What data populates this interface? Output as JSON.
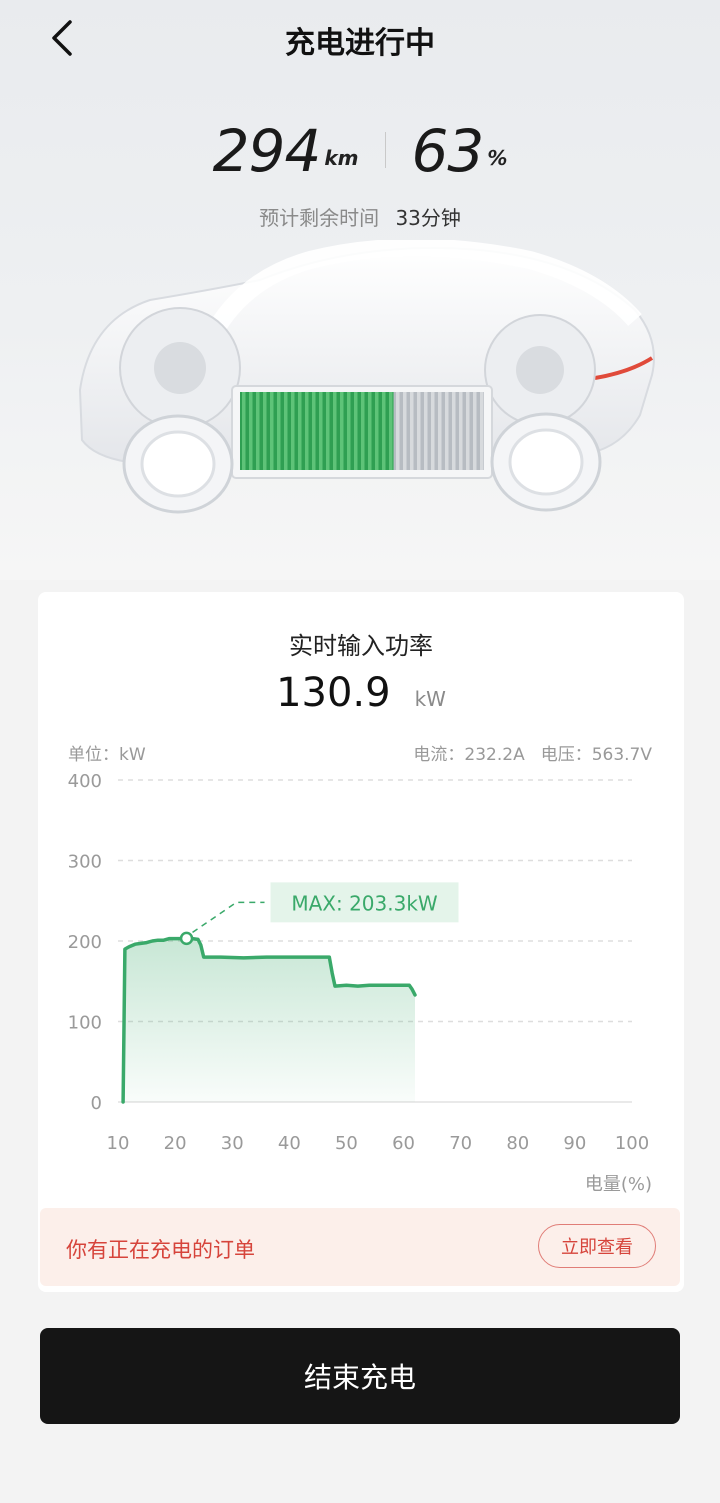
{
  "header": {
    "title": "充电进行中",
    "back_icon": "chevron-left-icon"
  },
  "stats": {
    "range_value": "294",
    "range_unit": "km",
    "battery_value": "63",
    "battery_unit": "%",
    "battery_fraction": 0.63,
    "remaining_label": "预计剩余时间",
    "remaining_value": "33分钟"
  },
  "power_card": {
    "title": "实时输入功率",
    "value": "130.9",
    "unit": "kW",
    "unit_label": "单位：kW",
    "current": "电流：232.2A",
    "voltage": "电压：563.7V"
  },
  "colors": {
    "accent_green": "#3aa96a",
    "notice_red": "#d6443b",
    "button_dark": "#151515"
  },
  "chart_data": {
    "type": "area",
    "ylim": [
      0,
      400
    ],
    "xlim": [
      10,
      100
    ],
    "y_ticks": [
      "0",
      "100",
      "200",
      "300",
      "400"
    ],
    "x_ticks": [
      "10",
      "20",
      "30",
      "40",
      "50",
      "60",
      "70",
      "80",
      "90",
      "100"
    ],
    "xlabel": "电量(%)",
    "annotation": "MAX: 203.3kW",
    "max_point": [
      22,
      203.3
    ],
    "x": [
      10.9,
      11.2,
      12,
      13,
      14,
      15,
      16,
      17,
      18,
      19,
      20,
      21,
      22,
      23,
      24,
      24.5,
      25,
      28,
      32,
      36,
      40,
      44,
      47,
      47.5,
      48,
      50,
      52,
      54,
      56,
      58,
      60,
      61,
      61.5,
      62
    ],
    "y": [
      0,
      190,
      193,
      196,
      197,
      198,
      200,
      201,
      201,
      203,
      203,
      203,
      203.3,
      203,
      202,
      195,
      180,
      180,
      179,
      180,
      180,
      180,
      180,
      160,
      144,
      145,
      144,
      145,
      145,
      145,
      145,
      145,
      140,
      133
    ]
  },
  "notice": {
    "text": "你有正在充电的订单",
    "button": "立即查看"
  },
  "end_button": "结束充电"
}
